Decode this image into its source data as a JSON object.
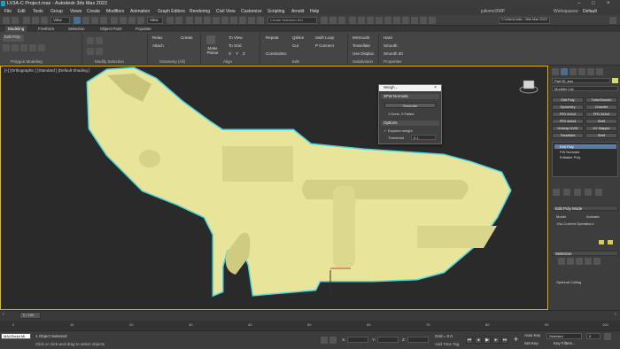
{
  "window": {
    "title": "LV3A-C Project.max - Autodesk 3ds Max 2022",
    "controls": [
      "–",
      "□",
      "×"
    ]
  },
  "menu": [
    "File",
    "Edit",
    "Tools",
    "Group",
    "Views",
    "Create",
    "Modifiers",
    "Animation",
    "Graph Editors",
    "Rendering",
    "Civil View",
    "Customize",
    "Scripting",
    "Arnold",
    "Help"
  ],
  "toolbar": {
    "view_dropdown": "View",
    "selection_set": "Create Selection Set",
    "workspace_label": "Workspaces:",
    "workspace_value": "Default",
    "user": "juliomcl3MP",
    "project_path": "C:\\Users\\Julio...\\3ds Max 2022"
  },
  "ribbon_tabs": [
    "Modeling",
    "Freeform",
    "Selection",
    "Object Paint",
    "Populate"
  ],
  "ribbon": {
    "left_labels": [
      "Edit Poly"
    ],
    "group_labels": [
      "Polygon Modeling",
      "Modify Selection",
      "Geometry (All)",
      "Align",
      "Edit",
      "Subdivision",
      "Properties"
    ],
    "buttons": {
      "relax": "Relax",
      "create": "Create",
      "attach": "Attach",
      "make_planar": "Make Planar",
      "to_view": "To View",
      "to_grid": "To Grid",
      "x": "X",
      "y": "Y",
      "z": "Z",
      "repeat": "Repeat",
      "qslice": "QSlice",
      "swift_loop": "Swift Loop",
      "p_connect": "P Connect",
      "cut": "Cut",
      "constraints": "Constraints:",
      "meshsmooth": "MSmooth",
      "tessellate": "Tessellate",
      "use_displace": "Use Displac.",
      "hard": "Hard",
      "smooth": "Smooth",
      "smooth30": "Smooth 30"
    }
  },
  "viewport": {
    "label": "[+] [Orthographic ] [Standard ] [Default Shading ]",
    "model_color": "#e8e49a",
    "outline_color": "#47d6e0"
  },
  "dialog": {
    "title": "Weigh...",
    "section1": "3PW Normals",
    "generate_button": "Generate",
    "status": "1 Done, 0 Failed",
    "section2": "Options",
    "checkbox_label": "Explorer weight",
    "threshold_label": "Threshold",
    "threshold_value": "0.1"
  },
  "command_panel": {
    "object_name": "Part ID_box",
    "modifier_list": "Modifier List",
    "swatch_color": "#d7dc6a",
    "buttons": [
      "Edit Poly",
      "TurboSmooth",
      "Symmetry",
      "Chamfer",
      "FFD 2x2x2",
      "FFD 3x3x3",
      "FFD 4x4x4",
      "Shell",
      "Unwrap UVW",
      "UV Mapper",
      "Tessellate",
      "Shell"
    ],
    "stack": [
      "Edit Poly",
      "FW Normals",
      "Editable Poly"
    ],
    "rollouts": {
      "edit_poly_mode": "Edit Poly Mode",
      "model": "Model",
      "animate": "Animate",
      "no_current_operation": "<No Current Operation>",
      "selection": "Selection",
      "optional_culling": "Optional Culling"
    }
  },
  "timeline": {
    "frame_counter": "0 / 100",
    "ticks": [
      "0",
      "10",
      "20",
      "30",
      "40",
      "50",
      "60",
      "70",
      "80",
      "90",
      "100"
    ]
  },
  "status": {
    "maxscript": "MAXScript Mi",
    "selected": "1 Object Selected",
    "hint": "Click or click-and-drag to select objects",
    "x_label": "X:",
    "y_label": "Y:",
    "z_label": "Z:",
    "grid": "Grid = 0.0",
    "add_time_tag": "Add Time Tag",
    "auto_key": "Auto Key",
    "selected_dropdown": "Selected",
    "set_key": "Set Key",
    "key_filters": "Key Filters...",
    "frame": "0"
  }
}
